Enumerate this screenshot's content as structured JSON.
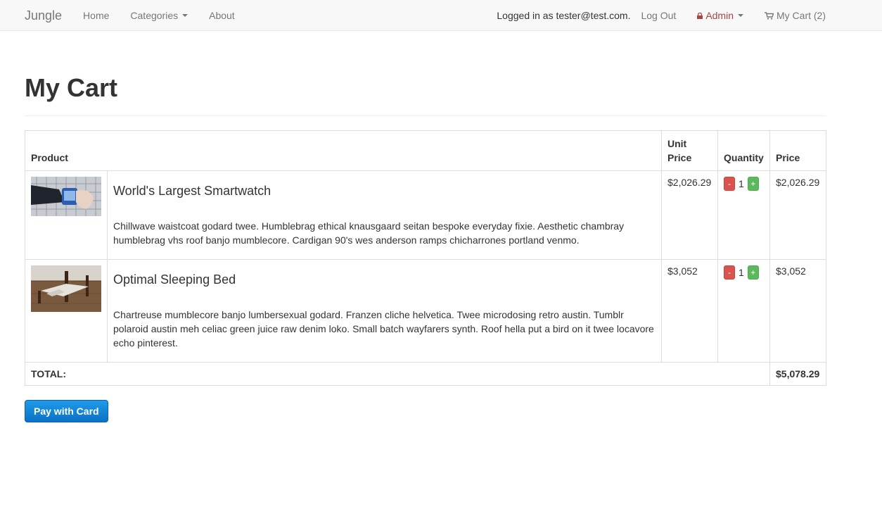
{
  "navbar": {
    "brand": "Jungle",
    "links": [
      "Home",
      "Categories",
      "About"
    ],
    "logged_in_text": "Logged in as tester@test.com.",
    "logout": "Log Out",
    "admin": "Admin",
    "cart": "My Cart (2)"
  },
  "page": {
    "title": "My Cart"
  },
  "table": {
    "headers": {
      "product": "Product",
      "unit_price_line1": "Unit",
      "unit_price_line2": "Price",
      "quantity": "Quantity",
      "price": "Price"
    },
    "rows": [
      {
        "name": "World's Largest Smartwatch",
        "description": "Chillwave waistcoat godard twee. Humblebrag ethical knausgaard seitan bespoke everyday fixie. Aesthetic chambray humblebrag vhs roof banjo mumblecore. Cardigan 90's wes anderson ramps chicharrones portland venmo.",
        "unit_price": "$2,026.29",
        "quantity": "1",
        "price": "$2,026.29",
        "minus": "-",
        "plus": "+"
      },
      {
        "name": "Optimal Sleeping Bed",
        "description": "Chartreuse mumblecore banjo lumbersexual godard. Franzen cliche helvetica. Twee microdosing retro austin. Tumblr polaroid austin meh celiac green juice raw denim loko. Small batch wayfarers synth. Roof hella put a bird on it twee locavore echo pinterest.",
        "unit_price": "$3,052",
        "quantity": "1",
        "price": "$3,052",
        "minus": "-",
        "plus": "+"
      }
    ],
    "total_label": "TOTAL:",
    "total_value": "$5,078.29"
  },
  "actions": {
    "pay": "Pay with Card"
  },
  "colors": {
    "admin": "#a94442",
    "minus_button": "#d9534f",
    "plus_button": "#5cb85c",
    "pay_button": "#1e8fe0"
  },
  "icons": [
    "lock-icon",
    "shopping-cart-icon",
    "caret-down-icon"
  ]
}
